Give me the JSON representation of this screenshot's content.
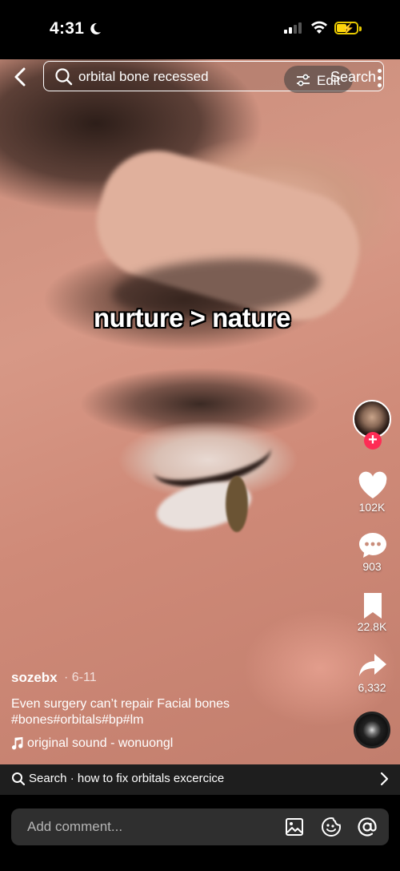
{
  "status": {
    "time": "4:31"
  },
  "header": {
    "search_query": "orbital bone recessed",
    "edit_label": "Edit",
    "search_label": "Search"
  },
  "video": {
    "overlay_text": "nurture > nature"
  },
  "rail": {
    "likes": "102K",
    "comments": "903",
    "saves": "22.8K",
    "shares": "6,332"
  },
  "post": {
    "username": "sozebx",
    "date": "· 6-11",
    "caption_line1": "Even surgery can’t repair Facial bones",
    "caption_line2": "#bones#orbitals#bp#lm",
    "sound": "original sound - wonuongl"
  },
  "related_search": {
    "text": "Search · how to fix orbitals excercice"
  },
  "comment": {
    "placeholder": "Add comment..."
  },
  "colors": {
    "follow": "#fe2c55",
    "battery": "#ffd60a"
  }
}
